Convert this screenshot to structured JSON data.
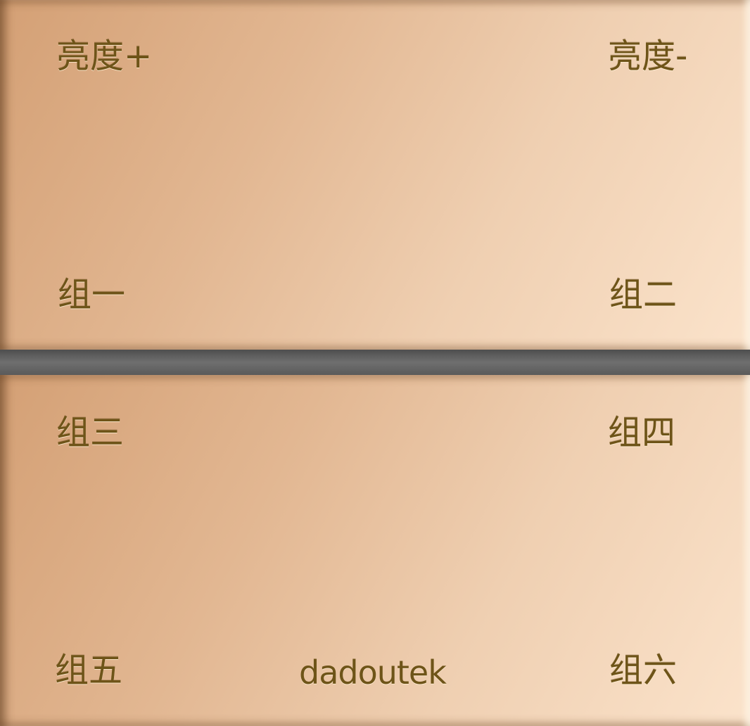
{
  "panel_top": {
    "brightness_up_label": "亮度+",
    "brightness_down_label": "亮度-",
    "group1_label": "组一",
    "group2_label": "组二"
  },
  "panel_bottom": {
    "group3_label": "组三",
    "group4_label": "组四",
    "group5_label": "组五",
    "group6_label": "组六",
    "brand_logo": "dadoutek"
  },
  "colors": {
    "label_text": "#6e5418",
    "panel_warm": "#d4a075",
    "panel_light": "#fbe3cb",
    "divider": "#646464"
  }
}
